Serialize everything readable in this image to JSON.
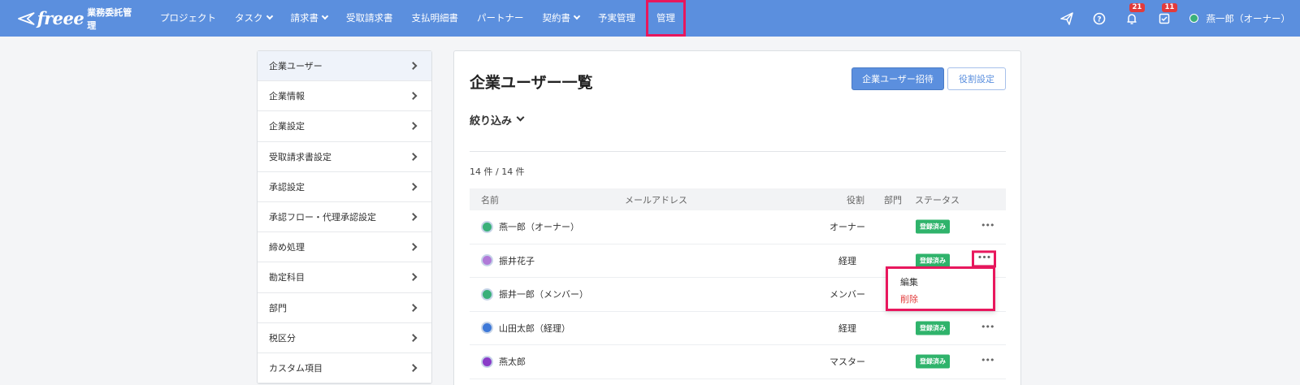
{
  "header": {
    "logo": "freee",
    "product": "業務委託管理",
    "nav": [
      {
        "label": "プロジェクト",
        "has_menu": false
      },
      {
        "label": "タスク",
        "has_menu": true
      },
      {
        "label": "請求書",
        "has_menu": true
      },
      {
        "label": "受取請求書",
        "has_menu": false
      },
      {
        "label": "支払明細書",
        "has_menu": false
      },
      {
        "label": "パートナー",
        "has_menu": false
      },
      {
        "label": "契約書",
        "has_menu": true
      },
      {
        "label": "予実管理",
        "has_menu": false
      },
      {
        "label": "管理",
        "has_menu": false
      }
    ],
    "notifications_count": "21",
    "tasks_count": "11",
    "user_name": "燕一郎（オーナー）",
    "accent": "#5b8fde",
    "highlight": "#e8175d"
  },
  "sidebar": {
    "items": [
      {
        "label": "企業ユーザー"
      },
      {
        "label": "企業情報"
      },
      {
        "label": "企業設定"
      },
      {
        "label": "受取請求書設定"
      },
      {
        "label": "承認設定"
      },
      {
        "label": "承認フロー・代理承認設定"
      },
      {
        "label": "締め処理"
      },
      {
        "label": "勘定科目"
      },
      {
        "label": "部門"
      },
      {
        "label": "税区分"
      },
      {
        "label": "カスタム項目"
      }
    ]
  },
  "main": {
    "title": "企業ユーザー一覧",
    "invite_button": "企業ユーザー招待",
    "role_settings_button": "役割設定",
    "filter_label": "絞り込み",
    "count": "14 件 / 14 件",
    "columns": {
      "name": "名前",
      "email": "メールアドレス",
      "role": "役割",
      "dept": "部門",
      "status": "ステータス"
    },
    "rows": [
      {
        "name": "燕一郎（オーナー）",
        "role": "オーナー",
        "status": "登録済み",
        "avatar_icon": "leaf-avatar-icon",
        "avatar_color": "#3ab07a"
      },
      {
        "name": "振井花子",
        "role": "経理",
        "status": "登録済み",
        "avatar_icon": "person-avatar-icon",
        "avatar_color": "#b07ad8"
      },
      {
        "name": "振井一郎（メンバー）",
        "role": "メンバー",
        "status": "登録済み",
        "avatar_icon": "leaf-avatar-icon",
        "avatar_color": "#3ab07a"
      },
      {
        "name": "山田太郎（経理）",
        "role": "経理",
        "status": "登録済み",
        "avatar_icon": "initial-avatar-icon",
        "avatar_color": "#3d78d8"
      },
      {
        "name": "燕太郎",
        "role": "マスター",
        "status": "登録済み",
        "avatar_icon": "initial-avatar-icon",
        "avatar_color": "#8a3cc8"
      }
    ],
    "row_menu": {
      "edit": "編集",
      "delete": "削除"
    }
  }
}
